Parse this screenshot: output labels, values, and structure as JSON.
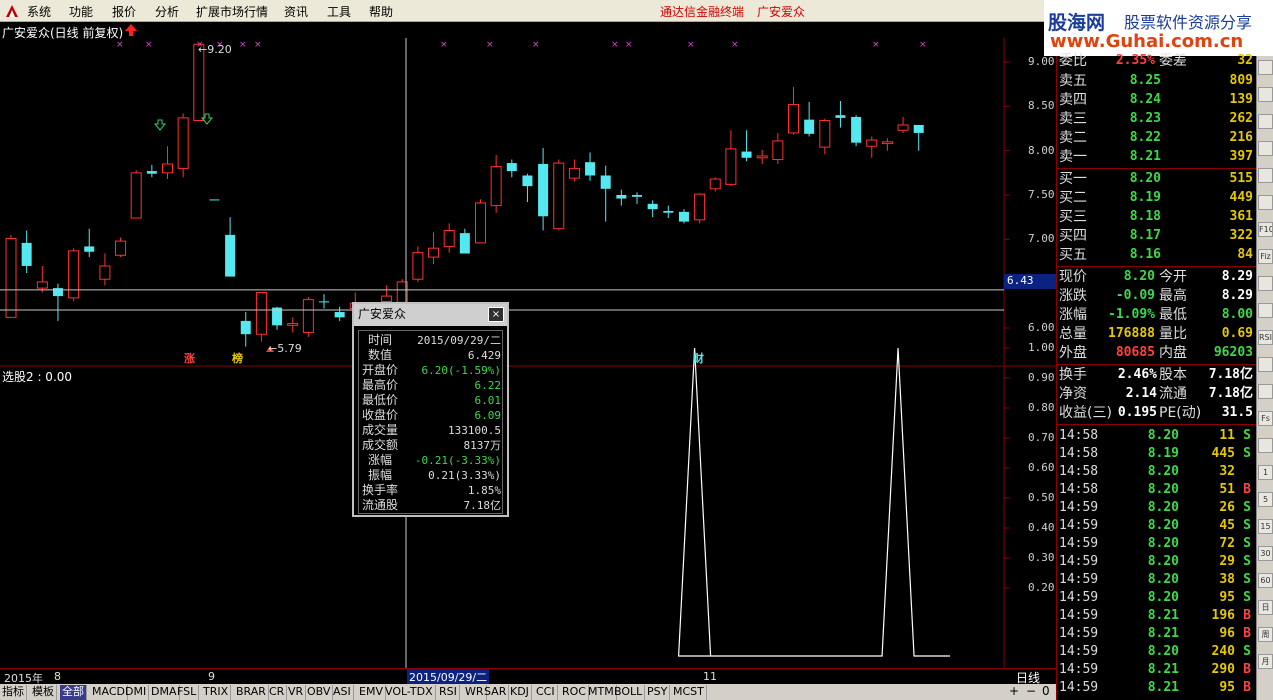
{
  "menu": {
    "items": [
      "系统",
      "功能",
      "报价",
      "分析",
      "扩展市场行情",
      "资讯",
      "工具",
      "帮助"
    ],
    "center_title": "通达信金融终端",
    "stock_title": "广安爱众"
  },
  "logo": {
    "name_cn": "股海网",
    "slogan": "股票软件资源分享",
    "url": "www.Guhai.com.cn"
  },
  "chart": {
    "title": "广安爱众(日线 前复权)",
    "high_label": "9.20",
    "low_label": "5.79",
    "price_ticks": [
      "9.00",
      "8.50",
      "8.00",
      "7.50",
      "7.00",
      "6.43",
      "6.00"
    ],
    "current_marker": "6.43",
    "markers": [
      "涨",
      "榜",
      "财"
    ],
    "indicator_title": "选股2 : 0.00",
    "indicator_ticks": [
      "1.00",
      "0.90",
      "0.80",
      "0.70",
      "0.60",
      "0.50",
      "0.40",
      "0.30",
      "0.20"
    ],
    "candles": [
      {
        "o": 6.12,
        "c": 7.01,
        "h": 7.05,
        "l": 6.12,
        "up": true
      },
      {
        "o": 6.96,
        "c": 6.7,
        "h": 7.1,
        "l": 6.62,
        "up": false
      },
      {
        "o": 6.45,
        "c": 6.52,
        "h": 6.7,
        "l": 6.4,
        "up": true
      },
      {
        "o": 6.45,
        "c": 6.36,
        "h": 6.5,
        "l": 6.08,
        "up": false
      },
      {
        "o": 6.34,
        "c": 6.87,
        "h": 6.9,
        "l": 6.3,
        "up": true
      },
      {
        "o": 6.92,
        "c": 6.86,
        "h": 7.12,
        "l": 6.8,
        "up": false
      },
      {
        "o": 6.55,
        "c": 6.7,
        "h": 6.84,
        "l": 6.48,
        "up": true
      },
      {
        "o": 6.82,
        "c": 6.98,
        "h": 7.02,
        "l": 6.8,
        "up": true
      },
      {
        "o": 7.24,
        "c": 7.75,
        "h": 7.78,
        "l": 7.24,
        "up": true
      },
      {
        "o": 7.77,
        "c": 7.74,
        "h": 7.84,
        "l": 7.7,
        "up": false
      },
      {
        "o": 7.75,
        "c": 7.85,
        "h": 8.05,
        "l": 7.68,
        "up": true
      },
      {
        "o": 7.8,
        "c": 8.37,
        "h": 8.42,
        "l": 7.7,
        "up": true
      },
      {
        "o": 8.34,
        "c": 9.2,
        "h": 9.2,
        "l": 8.34,
        "up": true
      },
      {
        "o": 7.45,
        "c": 7.45,
        "h": 7.45,
        "l": 7.45,
        "up": false
      },
      {
        "o": 7.05,
        "c": 6.58,
        "h": 7.25,
        "l": 6.58,
        "up": false
      },
      {
        "o": 6.08,
        "c": 5.93,
        "h": 6.18,
        "l": 5.79,
        "up": false
      },
      {
        "o": 5.93,
        "c": 6.4,
        "h": 6.4,
        "l": 5.85,
        "up": true
      },
      {
        "o": 6.23,
        "c": 6.03,
        "h": 6.24,
        "l": 5.98,
        "up": false
      },
      {
        "o": 6.03,
        "c": 6.05,
        "h": 6.12,
        "l": 5.95,
        "up": true
      },
      {
        "o": 5.95,
        "c": 6.32,
        "h": 6.35,
        "l": 5.9,
        "up": true
      },
      {
        "o": 6.3,
        "c": 6.3,
        "h": 6.38,
        "l": 6.22,
        "up": false
      },
      {
        "o": 6.18,
        "c": 6.12,
        "h": 6.24,
        "l": 6.08,
        "up": false
      },
      {
        "o": 6.22,
        "c": 6.28,
        "h": 6.4,
        "l": 6.18,
        "up": true
      },
      {
        "o": 6.2,
        "c": 6.09,
        "h": 6.22,
        "l": 6.01,
        "up": false
      },
      {
        "o": 6.3,
        "c": 6.36,
        "h": 6.48,
        "l": 6.25,
        "up": true
      },
      {
        "o": 6.29,
        "c": 6.52,
        "h": 6.55,
        "l": 6.25,
        "up": true
      },
      {
        "o": 6.55,
        "c": 6.85,
        "h": 6.92,
        "l": 6.52,
        "up": true
      },
      {
        "o": 6.8,
        "c": 6.9,
        "h": 7.08,
        "l": 6.72,
        "up": true
      },
      {
        "o": 6.92,
        "c": 7.1,
        "h": 7.18,
        "l": 6.85,
        "up": true
      },
      {
        "o": 7.07,
        "c": 6.84,
        "h": 7.12,
        "l": 6.84,
        "up": false
      },
      {
        "o": 6.96,
        "c": 7.41,
        "h": 7.45,
        "l": 6.96,
        "up": true
      },
      {
        "o": 7.38,
        "c": 7.82,
        "h": 7.95,
        "l": 7.3,
        "up": true
      },
      {
        "o": 7.86,
        "c": 7.77,
        "h": 7.9,
        "l": 7.7,
        "up": false
      },
      {
        "o": 7.72,
        "c": 7.6,
        "h": 7.74,
        "l": 7.42,
        "up": false
      },
      {
        "o": 7.85,
        "c": 7.26,
        "h": 8.03,
        "l": 7.1,
        "up": false
      },
      {
        "o": 7.12,
        "c": 7.86,
        "h": 7.9,
        "l": 7.1,
        "up": true
      },
      {
        "o": 7.69,
        "c": 7.8,
        "h": 7.9,
        "l": 7.65,
        "up": true
      },
      {
        "o": 7.87,
        "c": 7.72,
        "h": 7.98,
        "l": 7.66,
        "up": false
      },
      {
        "o": 7.72,
        "c": 7.57,
        "h": 7.83,
        "l": 7.2,
        "up": false
      },
      {
        "o": 7.5,
        "c": 7.46,
        "h": 7.56,
        "l": 7.38,
        "up": false
      },
      {
        "o": 7.5,
        "c": 7.48,
        "h": 7.53,
        "l": 7.4,
        "up": false
      },
      {
        "o": 7.4,
        "c": 7.34,
        "h": 7.44,
        "l": 7.25,
        "up": false
      },
      {
        "o": 7.32,
        "c": 7.3,
        "h": 7.38,
        "l": 7.24,
        "up": false
      },
      {
        "o": 7.31,
        "c": 7.2,
        "h": 7.34,
        "l": 7.18,
        "up": false
      },
      {
        "o": 7.22,
        "c": 7.51,
        "h": 7.52,
        "l": 7.18,
        "up": true
      },
      {
        "o": 7.57,
        "c": 7.68,
        "h": 7.7,
        "l": 7.54,
        "up": true
      },
      {
        "o": 7.62,
        "c": 8.02,
        "h": 8.23,
        "l": 7.6,
        "up": true
      },
      {
        "o": 7.99,
        "c": 7.92,
        "h": 8.23,
        "l": 7.88,
        "up": false
      },
      {
        "o": 7.92,
        "c": 7.94,
        "h": 8.01,
        "l": 7.85,
        "up": true
      },
      {
        "o": 7.9,
        "c": 8.11,
        "h": 8.2,
        "l": 7.85,
        "up": true
      },
      {
        "o": 8.2,
        "c": 8.52,
        "h": 8.72,
        "l": 8.18,
        "up": true
      },
      {
        "o": 8.35,
        "c": 8.19,
        "h": 8.55,
        "l": 8.16,
        "up": false
      },
      {
        "o": 8.04,
        "c": 8.34,
        "h": 8.36,
        "l": 7.96,
        "up": true
      },
      {
        "o": 8.4,
        "c": 8.37,
        "h": 8.56,
        "l": 8.26,
        "up": false
      },
      {
        "o": 8.38,
        "c": 8.09,
        "h": 8.4,
        "l": 8.05,
        "up": false
      },
      {
        "o": 8.05,
        "c": 8.12,
        "h": 8.16,
        "l": 7.92,
        "up": true
      },
      {
        "o": 8.08,
        "c": 8.1,
        "h": 8.14,
        "l": 8.0,
        "up": true
      },
      {
        "o": 8.23,
        "c": 8.29,
        "h": 8.38,
        "l": 8.2,
        "up": true
      },
      {
        "o": 8.29,
        "c": 8.2,
        "h": 8.29,
        "l": 8.0,
        "up": false
      }
    ],
    "signal_peaks": [
      44,
      57
    ]
  },
  "popup": {
    "title": "广安爱众",
    "close": "×",
    "rows": [
      {
        "label": "时间",
        "value": "2015/09/29/二",
        "color": "#dddddd"
      },
      {
        "label": "数值",
        "value": "6.429",
        "color": "#dddddd"
      },
      {
        "label": "开盘价",
        "value": "6.20(-1.59%)",
        "color": "#3cd94a"
      },
      {
        "label": "最高价",
        "value": "6.22",
        "color": "#3cd94a"
      },
      {
        "label": "最低价",
        "value": "6.01",
        "color": "#3cd94a"
      },
      {
        "label": "收盘价",
        "value": "6.09",
        "color": "#3cd94a"
      },
      {
        "label": "成交量",
        "value": "133100.5",
        "color": "#dddddd"
      },
      {
        "label": "成交额",
        "value": "8137万",
        "color": "#dddddd"
      },
      {
        "label": "涨幅",
        "value": "-0.21(-3.33%)",
        "color": "#3cd94a"
      },
      {
        "label": "振幅",
        "value": "0.21(3.33%)",
        "color": "#dddddd"
      },
      {
        "label": "换手率",
        "value": "1.85%",
        "color": "#dddddd"
      },
      {
        "label": "流通股",
        "value": "7.18亿",
        "color": "#dddddd"
      }
    ]
  },
  "quote": {
    "top_partial": {
      "l1": "委比",
      "v1": "2.35%",
      "l2": "委差",
      "v2": "32"
    },
    "asks": [
      {
        "label": "卖五",
        "price": "8.25",
        "vol": "809"
      },
      {
        "label": "卖四",
        "price": "8.24",
        "vol": "139"
      },
      {
        "label": "卖三",
        "price": "8.23",
        "vol": "262"
      },
      {
        "label": "卖二",
        "price": "8.22",
        "vol": "216"
      },
      {
        "label": "卖一",
        "price": "8.21",
        "vol": "397"
      }
    ],
    "bids": [
      {
        "label": "买一",
        "price": "8.20",
        "vol": "515"
      },
      {
        "label": "买二",
        "price": "8.19",
        "vol": "449"
      },
      {
        "label": "买三",
        "price": "8.18",
        "vol": "361"
      },
      {
        "label": "买四",
        "price": "8.17",
        "vol": "322"
      },
      {
        "label": "买五",
        "price": "8.16",
        "vol": "84"
      }
    ],
    "stats": [
      {
        "l1": "现价",
        "v1": "8.20",
        "c1": "#3cd94a",
        "l2": "今开",
        "v2": "8.29",
        "c2": "#ffffff"
      },
      {
        "l1": "涨跌",
        "v1": "-0.09",
        "c1": "#3cd94a",
        "l2": "最高",
        "v2": "8.29",
        "c2": "#ffffff"
      },
      {
        "l1": "涨幅",
        "v1": "-1.09%",
        "c1": "#3cd94a",
        "l2": "最低",
        "v2": "8.00",
        "c2": "#3cd94a"
      },
      {
        "l1": "总量",
        "v1": "176888",
        "c1": "#e6c800",
        "l2": "量比",
        "v2": "0.69",
        "c2": "#e6c800"
      },
      {
        "l1": "外盘",
        "v1": "80685",
        "c1": "#ff4040",
        "l2": "内盘",
        "v2": "96203",
        "c2": "#3cd94a"
      }
    ],
    "stats2": [
      {
        "l1": "换手",
        "v1": "2.46%",
        "c1": "#ffffff",
        "l2": "股本",
        "v2": "7.18亿",
        "c2": "#ffffff"
      },
      {
        "l1": "净资",
        "v1": "2.14",
        "c1": "#ffffff",
        "l2": "流通",
        "v2": "7.18亿",
        "c2": "#ffffff"
      },
      {
        "l1": "收益(三)",
        "v1": "0.195",
        "c1": "#ffffff",
        "l2": "PE(动)",
        "v2": "31.5",
        "c2": "#ffffff"
      }
    ],
    "ticks": [
      {
        "time": "14:58",
        "price": "8.20",
        "vol": "11",
        "dir": "S"
      },
      {
        "time": "14:58",
        "price": "8.19",
        "vol": "445",
        "dir": "S"
      },
      {
        "time": "14:58",
        "price": "8.20",
        "vol": "32",
        "dir": ""
      },
      {
        "time": "14:58",
        "price": "8.20",
        "vol": "51",
        "dir": "B"
      },
      {
        "time": "14:59",
        "price": "8.20",
        "vol": "26",
        "dir": "S"
      },
      {
        "time": "14:59",
        "price": "8.20",
        "vol": "45",
        "dir": "S"
      },
      {
        "time": "14:59",
        "price": "8.20",
        "vol": "72",
        "dir": "S"
      },
      {
        "time": "14:59",
        "price": "8.20",
        "vol": "29",
        "dir": "S"
      },
      {
        "time": "14:59",
        "price": "8.20",
        "vol": "38",
        "dir": "S"
      },
      {
        "time": "14:59",
        "price": "8.20",
        "vol": "95",
        "dir": "S"
      },
      {
        "time": "14:59",
        "price": "8.21",
        "vol": "196",
        "dir": "B"
      },
      {
        "time": "14:59",
        "price": "8.21",
        "vol": "96",
        "dir": "B"
      },
      {
        "time": "14:59",
        "price": "8.20",
        "vol": "240",
        "dir": "S"
      },
      {
        "time": "14:59",
        "price": "8.21",
        "vol": "290",
        "dir": "B"
      },
      {
        "time": "14:59",
        "price": "8.21",
        "vol": "95",
        "dir": "B"
      }
    ]
  },
  "dateaxis": {
    "labels": [
      "2015年",
      "8",
      "9",
      "2015/09/29/二",
      "11"
    ],
    "period": "日线",
    "zoom": [
      "+",
      "−",
      "0"
    ]
  },
  "tabs": [
    "指标",
    "模板",
    "全部",
    "MACD",
    "DMI",
    "DMA",
    "FSL",
    "TRIX",
    "BRAR",
    "CR",
    "VR",
    "OBV",
    "ASI",
    "EMV",
    "VOL-TDX",
    "RSI",
    "WR",
    "SAR",
    "KDJ",
    "CCI",
    "ROC",
    "MTM",
    "BOLL",
    "PSY",
    "MCST"
  ],
  "rtool": [
    "",
    "",
    "",
    "",
    "",
    "",
    "F10",
    "Fiz",
    "",
    "",
    "RSI",
    "",
    "",
    "Fs",
    "",
    "1",
    "5",
    "15",
    "30",
    "60",
    "日",
    "周",
    "月"
  ],
  "colors": {
    "up": "#ff3030",
    "down": "#54e8f0",
    "bg": "#000000",
    "grid": "#8a0000"
  }
}
